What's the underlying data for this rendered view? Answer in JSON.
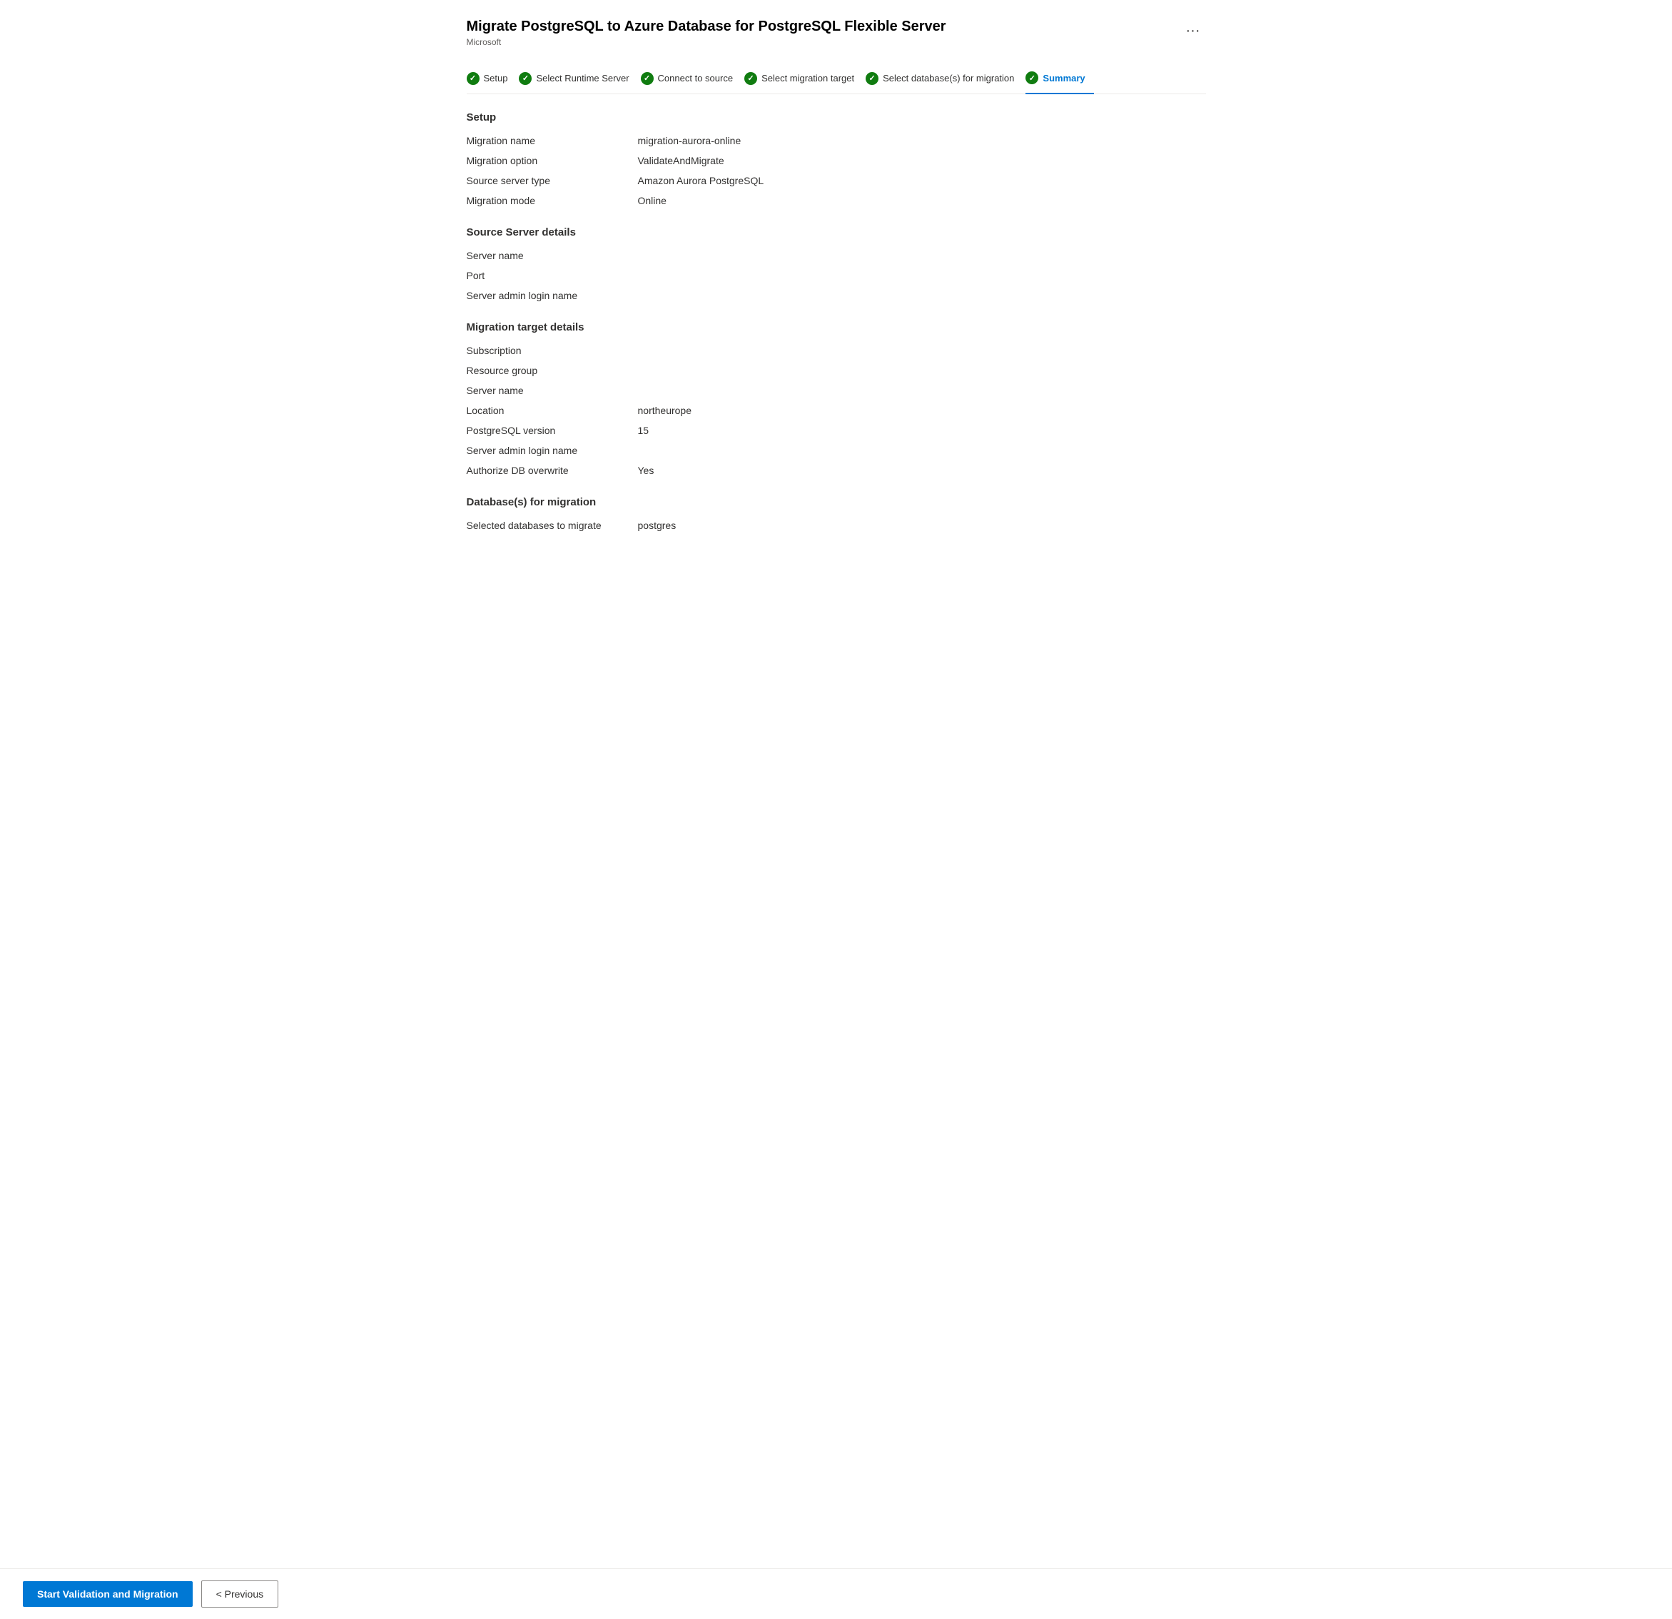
{
  "page": {
    "title": "Migrate PostgreSQL to Azure Database for PostgreSQL Flexible Server",
    "subtitle": "Microsoft",
    "more_tooltip": "More options"
  },
  "wizard": {
    "steps": [
      {
        "id": "setup",
        "label": "Setup",
        "completed": true,
        "active": false
      },
      {
        "id": "runtime-server",
        "label": "Select Runtime Server",
        "completed": true,
        "active": false
      },
      {
        "id": "connect-source",
        "label": "Connect to source",
        "completed": true,
        "active": false
      },
      {
        "id": "migration-target",
        "label": "Select migration target",
        "completed": true,
        "active": false
      },
      {
        "id": "select-databases",
        "label": "Select database(s) for migration",
        "completed": true,
        "active": false
      },
      {
        "id": "summary",
        "label": "Summary",
        "completed": true,
        "active": true
      }
    ]
  },
  "sections": {
    "setup": {
      "title": "Setup",
      "fields": [
        {
          "label": "Migration name",
          "value": "migration-aurora-online"
        },
        {
          "label": "Migration option",
          "value": "ValidateAndMigrate"
        },
        {
          "label": "Source server type",
          "value": "Amazon Aurora PostgreSQL"
        },
        {
          "label": "Migration mode",
          "value": "Online"
        }
      ]
    },
    "source_server": {
      "title": "Source Server details",
      "fields": [
        {
          "label": "Server name",
          "value": ""
        },
        {
          "label": "Port",
          "value": ""
        },
        {
          "label": "Server admin login name",
          "value": ""
        }
      ]
    },
    "migration_target": {
      "title": "Migration target details",
      "fields": [
        {
          "label": "Subscription",
          "value": ""
        },
        {
          "label": "Resource group",
          "value": ""
        },
        {
          "label": "Server name",
          "value": ""
        },
        {
          "label": "Location",
          "value": "northeurope"
        },
        {
          "label": "PostgreSQL version",
          "value": "15"
        },
        {
          "label": "Server admin login name",
          "value": ""
        },
        {
          "label": "Authorize DB overwrite",
          "value": "Yes"
        }
      ]
    },
    "databases": {
      "title": "Database(s) for migration",
      "fields": [
        {
          "label": "Selected databases to migrate",
          "value": "postgres"
        }
      ]
    }
  },
  "footer": {
    "start_button": "Start Validation and Migration",
    "previous_button": "< Previous"
  }
}
